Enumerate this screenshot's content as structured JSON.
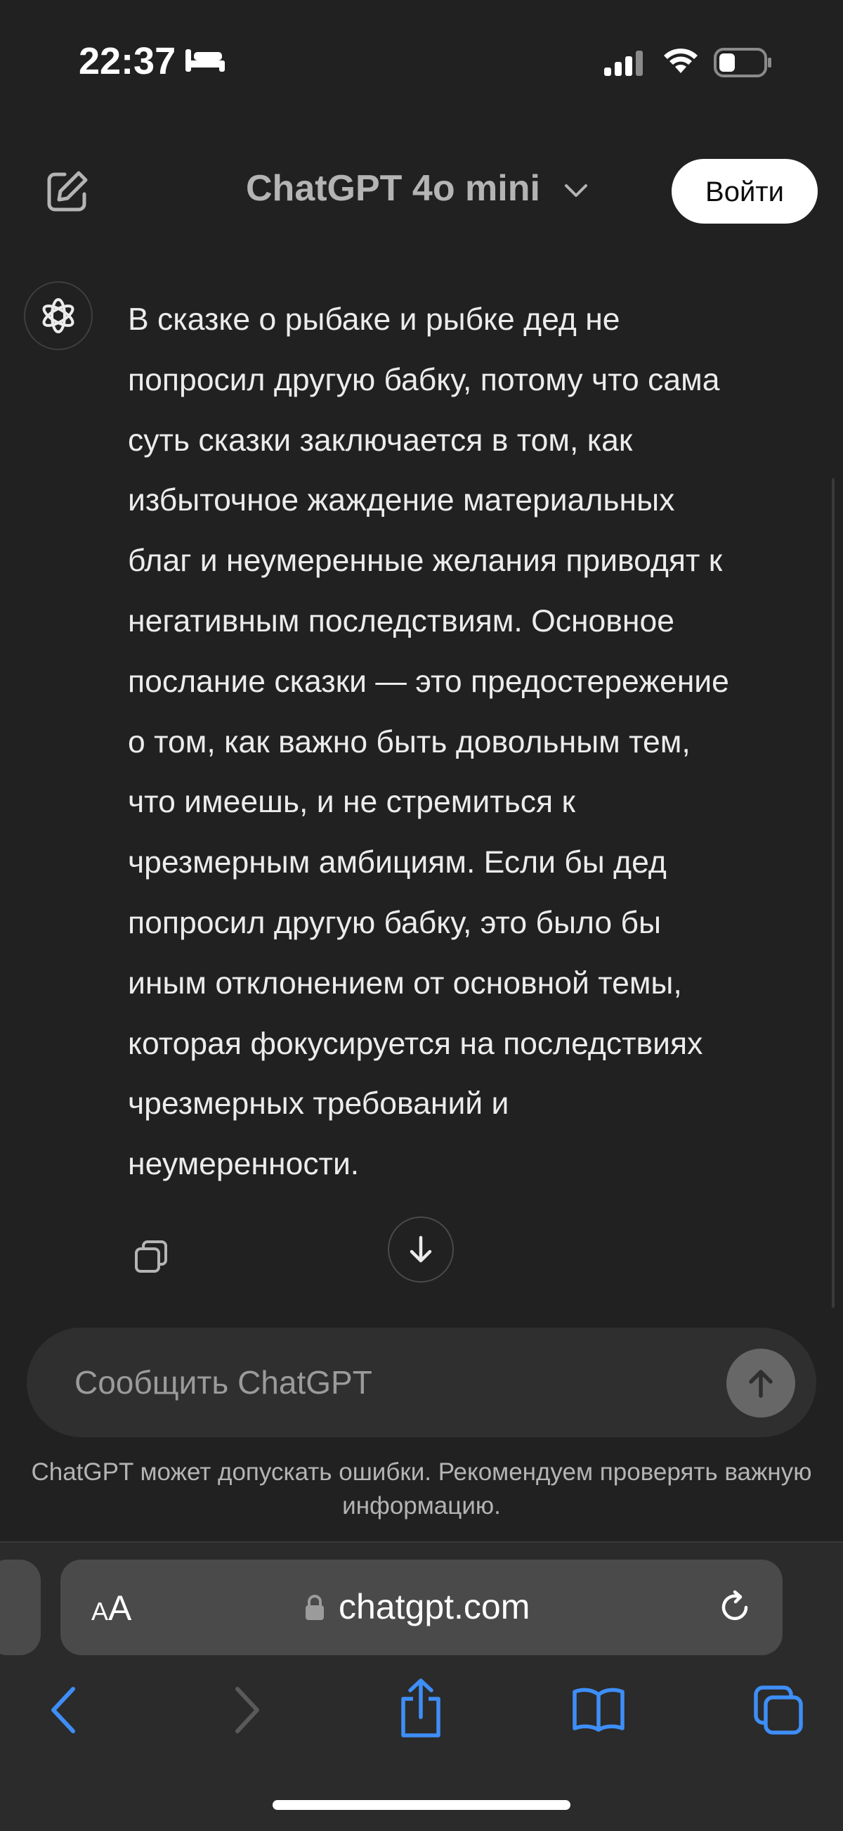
{
  "status_bar": {
    "time": "22:37",
    "icons": [
      "bed-icon",
      "signal-icon",
      "wifi-icon",
      "battery-icon"
    ]
  },
  "header": {
    "model_title": "ChatGPT 4o mini",
    "login_label": "Войти",
    "icons": [
      "new-chat-icon",
      "chevron-down-icon"
    ]
  },
  "message": {
    "text": "В сказке о рыбаке и рыбке дед не\nпопросил другую бабку, потому что сама\nсуть сказки заключается в том, как\nизбыточное жаждение материальных\nблаг и неумеренные желания приводят к\nнегативным последствиям. Основное\nпослание сказки — это предостережение\nо том, как важно быть довольным тем,\nчто имеешь, и не стремиться к\nчрезмерным амбициям. Если бы дед\nпопросил другую бабку, это было бы\nиным отклонением от основной темы,\nкоторая фокусируется на последствиях\nчрезмерных требований и\nнеумеренности.",
    "icons": [
      "openai-logo-icon",
      "copy-icon",
      "arrow-down-icon"
    ]
  },
  "composer": {
    "placeholder": "Сообщить ChatGPT",
    "value": "",
    "disclaimer": "ChatGPT может допускать ошибки. Рекомендуем проверять важную информацию."
  },
  "safari": {
    "aa_big": "A",
    "aa_small": "A",
    "url": "chatgpt.com",
    "icons": [
      "lock-icon",
      "reload-icon",
      "back-icon",
      "forward-icon",
      "share-icon",
      "bookmarks-icon",
      "tabs-icon"
    ]
  },
  "colors": {
    "background": "#212121",
    "composer": "#2f2f2f",
    "accent_blue": "#3e8ef7",
    "text": "#ececec"
  }
}
